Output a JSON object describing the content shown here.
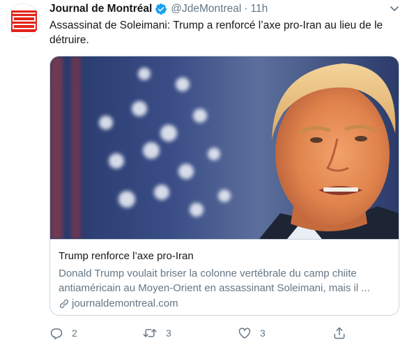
{
  "account": {
    "name": "Journal de Montréal",
    "handle": "@JdeMontreal",
    "separator": "·",
    "time": "11h",
    "verified": true,
    "avatar_logo_text": "LE JOURNAL DE MONTRÉAL"
  },
  "tweet": {
    "text": "Assassinat de Soleimani: Trump a renforcé l’axe pro-Iran au lieu de le détruire."
  },
  "card": {
    "title": "Trump renforce l’axe pro-Iran",
    "description": "Donald Trump voulait briser la colonne vertébrale du camp chiite antiaméricain au Moyen-Orient en assassinant Soleimani, mais il ...",
    "domain": "journaldemontreal.com",
    "image_icon": "photo"
  },
  "actions": {
    "reply": {
      "icon": "reply-icon",
      "count": "2"
    },
    "retweet": {
      "icon": "retweet-icon",
      "count": "3"
    },
    "like": {
      "icon": "heart-icon",
      "count": "3"
    },
    "share": {
      "icon": "share-icon"
    }
  },
  "colors": {
    "text": "#14171a",
    "secondary": "#657786",
    "border": "#ccd6dd",
    "verified": "#1da1f2",
    "logo_red": "#e2231a"
  }
}
